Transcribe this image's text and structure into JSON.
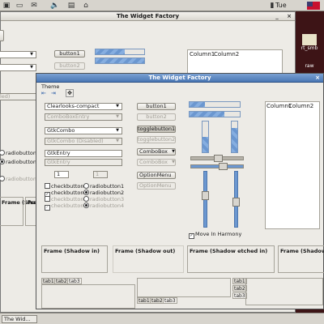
{
  "panel": {
    "clock": "Tue"
  },
  "desktop": {
    "icons": [
      {
        "label": "rt_smb"
      },
      {
        "label": "raw"
      }
    ]
  },
  "back_window": {
    "title": "The Widget Factory",
    "buttons": [
      "button1",
      "button2"
    ],
    "tree_columns": [
      "Column1",
      "Column2"
    ],
    "entry_label": "led)",
    "radios": [
      "radiobutton1",
      "radiobutton2",
      "radiobutton3"
    ],
    "frame_labels": [
      "Frame (Sha",
      "Fra"
    ]
  },
  "front_window": {
    "title": "The Widget Factory",
    "menu": [
      "Theme"
    ],
    "combos": [
      {
        "value": "Clearlooks-compact",
        "disabled": false
      },
      {
        "value": "ComboBoxEntry",
        "disabled": true
      },
      {
        "value": "GtkCombo",
        "disabled": false
      },
      {
        "value": "GtkCombo (Disabled)",
        "disabled": true
      }
    ],
    "entries": [
      {
        "value": "GtkEntry",
        "disabled": false
      },
      {
        "value": "GtkEntry",
        "disabled": true
      }
    ],
    "spin_values": [
      "1",
      "1"
    ],
    "checks": [
      {
        "label": "checkbutton1",
        "checked": false,
        "disabled": false
      },
      {
        "label": "checkbutton2",
        "checked": true,
        "disabled": false
      },
      {
        "label": "checkbutton3",
        "checked": false,
        "disabled": true
      },
      {
        "label": "checkbutton4",
        "checked": true,
        "disabled": true
      }
    ],
    "radios": [
      {
        "label": "radiobutton1",
        "on": false,
        "disabled": false
      },
      {
        "label": "radiobutton2",
        "on": true,
        "disabled": false
      },
      {
        "label": "radiobutton3",
        "on": false,
        "disabled": true
      },
      {
        "label": "radiobutton4",
        "on": true,
        "disabled": true
      }
    ],
    "buttons": [
      {
        "label": "button1",
        "disabled": false,
        "toggle": false
      },
      {
        "label": "button2",
        "disabled": true,
        "toggle": false
      },
      {
        "label": "togglebutton1",
        "disabled": false,
        "toggle": true
      },
      {
        "label": "togglebutton2",
        "disabled": true,
        "toggle": true
      },
      {
        "label": "ComboBox",
        "disabled": false,
        "toggle": false
      },
      {
        "label": "ComboBox",
        "disabled": true,
        "toggle": false
      },
      {
        "label": "OptionMenu",
        "disabled": false,
        "toggle": false
      },
      {
        "label": "OptionMenu",
        "disabled": true,
        "toggle": false
      }
    ],
    "move_in_harmony": "Move In Harmony",
    "tree_columns": [
      "Column1",
      "Column2"
    ],
    "frames": [
      "Frame (Shadow in)",
      "Frame (Shadow out)",
      "Frame (Shadow etched in)",
      "Frame (Shadow"
    ],
    "tabs_a": [
      "tab1",
      "tab2",
      "tab3"
    ],
    "tabs_b": [
      "tab1",
      "tab2",
      "tab3"
    ],
    "tabs_c": [
      "tab1",
      "tab2",
      "tab3"
    ],
    "progress": {
      "h1": 0.3,
      "h2": 0.7,
      "v1": 0.5,
      "v2": 0.8
    }
  },
  "taskbar": {
    "item": "The Wid..."
  },
  "colors": {
    "title_active": "#4a77b4",
    "progress": "#6b97d0"
  }
}
